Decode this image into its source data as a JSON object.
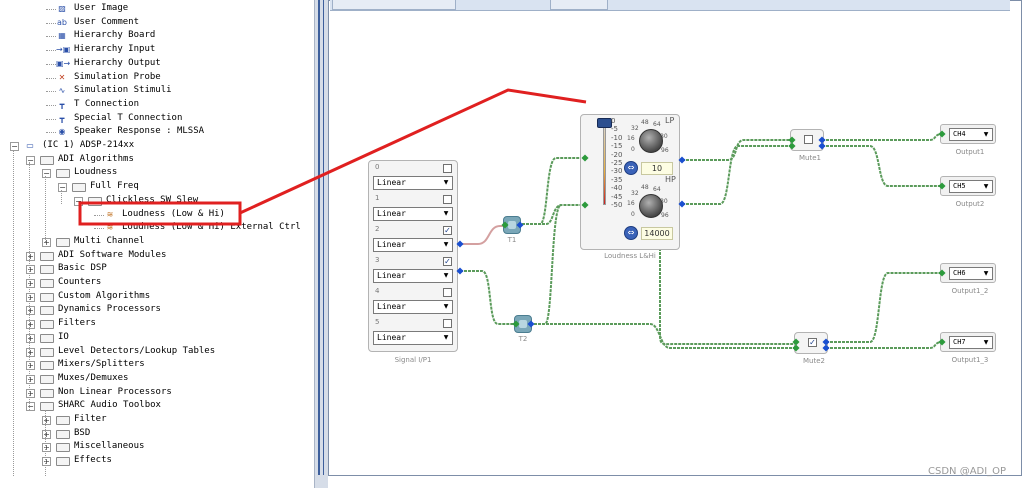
{
  "tree": {
    "items": [
      {
        "label": "User Image",
        "indent": 2,
        "icon": "user-image-icon"
      },
      {
        "label": "User Comment",
        "indent": 2,
        "icon": "user-comment-icon"
      },
      {
        "label": "Hierarchy Board",
        "indent": 2,
        "icon": "hierarchy-board-icon"
      },
      {
        "label": "Hierarchy Input",
        "indent": 2,
        "icon": "hierarchy-input-icon"
      },
      {
        "label": "Hierarchy Output",
        "indent": 2,
        "icon": "hierarchy-output-icon"
      },
      {
        "label": "Simulation Probe",
        "indent": 2,
        "icon": "simulation-probe-icon"
      },
      {
        "label": "Simulation Stimuli",
        "indent": 2,
        "icon": "simulation-stimuli-icon"
      },
      {
        "label": "T Connection",
        "indent": 2,
        "icon": "t-connection-icon"
      },
      {
        "label": "Special T Connection",
        "indent": 2,
        "icon": "special-t-connection-icon"
      },
      {
        "label": "Speaker Response : MLSSA",
        "indent": 2,
        "icon": "speaker-response-icon"
      },
      {
        "label": "(IC 1) ADSP-214xx",
        "indent": 0,
        "icon": "ic-chip-icon",
        "expander": "−"
      },
      {
        "label": "ADI Algorithms",
        "indent": 1,
        "icon": "folder-icon",
        "expander": "−"
      },
      {
        "label": "Loudness",
        "indent": 2,
        "icon": "folder-icon",
        "expander": "−"
      },
      {
        "label": "Full Freq",
        "indent": 3,
        "icon": "folder-icon",
        "expander": "−"
      },
      {
        "label": "Clickless SW Slew",
        "indent": 4,
        "icon": "folder-icon",
        "expander": "−"
      },
      {
        "label": "Loudness (Low & Hi)",
        "indent": 5,
        "icon": "loudness-module-icon",
        "highlighted": true
      },
      {
        "label": "Loudness (Low & Hi) External Ctrl",
        "indent": 5,
        "icon": "loudness-module-icon"
      },
      {
        "label": "Multi Channel",
        "indent": 2,
        "icon": "folder-icon",
        "expander": "+"
      },
      {
        "label": "ADI Software Modules",
        "indent": 1,
        "icon": "folder-icon",
        "expander": "+"
      },
      {
        "label": "Basic DSP",
        "indent": 1,
        "icon": "folder-icon",
        "expander": "+"
      },
      {
        "label": "Counters",
        "indent": 1,
        "icon": "folder-icon",
        "expander": "+"
      },
      {
        "label": "Custom Algorithms",
        "indent": 1,
        "icon": "folder-icon",
        "expander": "+"
      },
      {
        "label": "Dynamics Processors",
        "indent": 1,
        "icon": "folder-icon",
        "expander": "+"
      },
      {
        "label": "Filters",
        "indent": 1,
        "icon": "folder-icon",
        "expander": "+"
      },
      {
        "label": "IO",
        "indent": 1,
        "icon": "folder-icon",
        "expander": "+"
      },
      {
        "label": "Level Detectors/Lookup Tables",
        "indent": 1,
        "icon": "folder-icon",
        "expander": "+"
      },
      {
        "label": "Mixers/Splitters",
        "indent": 1,
        "icon": "folder-icon",
        "expander": "+"
      },
      {
        "label": "Muxes/Demuxes",
        "indent": 1,
        "icon": "folder-icon",
        "expander": "+"
      },
      {
        "label": "Non Linear Processors",
        "indent": 1,
        "icon": "folder-icon",
        "expander": "+"
      },
      {
        "label": "SHARC Audio Toolbox",
        "indent": 1,
        "icon": "folder-icon",
        "expander": "−"
      },
      {
        "label": "Filter",
        "indent": 2,
        "icon": "folder-icon",
        "expander": "+"
      },
      {
        "label": "BSD",
        "indent": 2,
        "icon": "folder-icon",
        "expander": "+"
      },
      {
        "label": "Miscellaneous",
        "indent": 2,
        "icon": "folder-icon",
        "expander": "+"
      },
      {
        "label": "Effects",
        "indent": 2,
        "icon": "folder-icon",
        "expander": "+"
      }
    ]
  },
  "signal_input": {
    "label": "Signal I/P1",
    "channels": [
      {
        "index": "0",
        "mode": "Linear",
        "checked": false
      },
      {
        "index": "1",
        "mode": "Linear",
        "checked": false
      },
      {
        "index": "2",
        "mode": "Linear",
        "checked": true
      },
      {
        "index": "3",
        "mode": "Linear",
        "checked": true
      },
      {
        "index": "4",
        "mode": "Linear",
        "checked": false
      },
      {
        "index": "5",
        "mode": "Linear",
        "checked": false
      }
    ]
  },
  "t1": {
    "label": "T1"
  },
  "t2": {
    "label": "T2"
  },
  "loudness": {
    "label": "Loudness L&Hi",
    "slider_ticks": [
      "0",
      "-5",
      "-10",
      "-15",
      "-20",
      "-25",
      "-30",
      "-35",
      "-40",
      "-45",
      "-50"
    ],
    "lp_label": "LP",
    "hp_label": "HP",
    "lp_ticks": [
      "32",
      "48",
      "64",
      "16",
      "80",
      "0",
      "96"
    ],
    "hp_ticks": [
      "32",
      "48",
      "64",
      "16",
      "80",
      "0",
      "96"
    ],
    "lp_value": "10",
    "hp_value": "14000"
  },
  "mute1": {
    "label": "Mute1",
    "checked": false
  },
  "mute2": {
    "label": "Mute2",
    "checked": true
  },
  "outputs": [
    {
      "label": "Output1",
      "channel": "CH4"
    },
    {
      "label": "Output2",
      "channel": "CH5"
    },
    {
      "label": "Output1_2",
      "channel": "CH6"
    },
    {
      "label": "Output1_3",
      "channel": "CH7"
    }
  ],
  "watermark": "CSDN @ADI_OP",
  "colors": {
    "wire": "#5b9b5b",
    "wire_selected": "#d4a0a0",
    "highlight": "#e02020",
    "port": "#1a4fd0"
  }
}
